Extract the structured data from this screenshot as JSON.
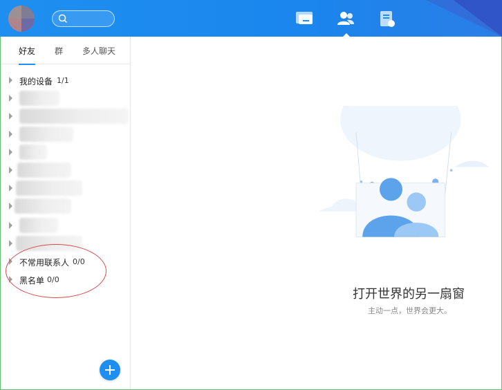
{
  "search": {
    "placeholder": ""
  },
  "nav": {
    "chat_icon": "chat-bubble-icon",
    "contacts_icon": "contacts-icon",
    "files_icon": "file-icon"
  },
  "tabs": [
    {
      "label": "好友"
    },
    {
      "label": "群"
    },
    {
      "label": "多人聊天"
    }
  ],
  "groups": {
    "devices": {
      "name": "我的设备",
      "count": "1/1"
    },
    "infrequent": {
      "name": "不常用联系人",
      "count": "0/0"
    },
    "blacklist": {
      "name": "黑名单",
      "count": "0/0"
    }
  },
  "main": {
    "slogan": "打开世界的另一扇窗",
    "subtitle": "主动一点，世界会更大。"
  },
  "colors": {
    "accent": "#1e8ff0",
    "annotation": "#d94b4b"
  }
}
